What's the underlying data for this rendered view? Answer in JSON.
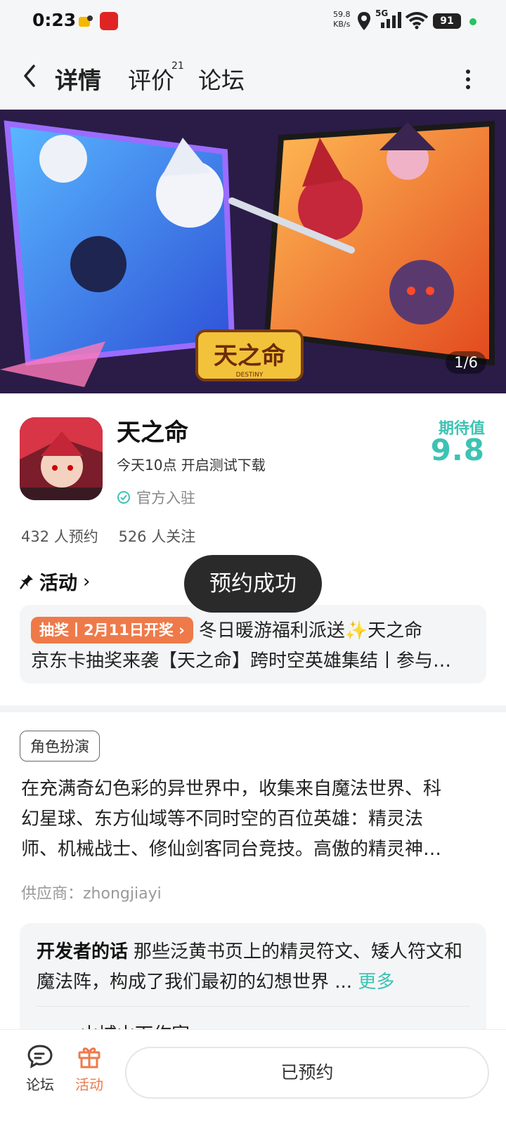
{
  "status_bar": {
    "time": "0:23",
    "speed_value": "59.8",
    "speed_unit": "KB/s",
    "network": "5G",
    "wifi_badge": "6",
    "battery": "91"
  },
  "nav": {
    "tabs": [
      {
        "label": "详情",
        "active": true
      },
      {
        "label": "评价",
        "sup": "21"
      },
      {
        "label": "论坛"
      }
    ]
  },
  "banner": {
    "counter": "1/6",
    "logo_text": "天之命",
    "logo_sub": "DESTINY"
  },
  "game": {
    "title": "天之命",
    "subtitle": "今天10点 开启测试下载",
    "official_label": "官方入驻",
    "expect_label": "期待值",
    "expect_value": "9.8",
    "reservations": "432 人预约",
    "follows": "526 人关注"
  },
  "activity": {
    "label": "活动",
    "badge": "抽奖丨2月11日开奖 ›",
    "line1": "冬日暖游福利派送✨天之命",
    "line2": "京东卡抽奖来袭【天之命】跨时空英雄集结丨参与…"
  },
  "toast": "预约成功",
  "details": {
    "tag": "角色扮演",
    "desc_l1": "在充满奇幻色彩的异世界中，收集来自魔法世界、科",
    "desc_l2": "幻星球、东方仙域等不同时空的百位英雄：精灵法",
    "desc_l3": "师、机械战士、修仙剑客同台竞技。高傲的精灵神…",
    "supplier": "供应商：zhongjiayi"
  },
  "developer": {
    "heading": "开发者的话",
    "text": "那些泛黄书页上的精灵符文、矮人符文和魔法阵，构成了我们最初的幻想世界 ...",
    "more": "更多",
    "name": "山城山下作家"
  },
  "bottom_bar": {
    "forum_label": "论坛",
    "activity_label": "活动",
    "reserved_label": "已预约"
  },
  "colors": {
    "accent": "#3cc3b4",
    "orange": "#ee7a4a",
    "toast_bg": "#2a2a2a"
  }
}
